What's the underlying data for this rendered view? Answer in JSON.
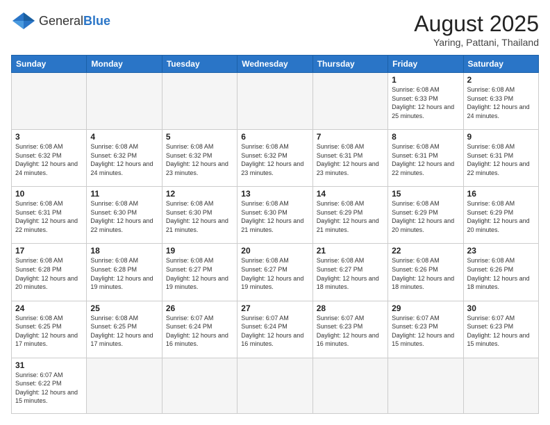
{
  "logo": {
    "text_general": "General",
    "text_blue": "Blue"
  },
  "header": {
    "title": "August 2025",
    "subtitle": "Yaring, Pattani, Thailand"
  },
  "days_of_week": [
    "Sunday",
    "Monday",
    "Tuesday",
    "Wednesday",
    "Thursday",
    "Friday",
    "Saturday"
  ],
  "weeks": [
    [
      {
        "day": "",
        "info": "",
        "empty": true
      },
      {
        "day": "",
        "info": "",
        "empty": true
      },
      {
        "day": "",
        "info": "",
        "empty": true
      },
      {
        "day": "",
        "info": "",
        "empty": true
      },
      {
        "day": "",
        "info": "",
        "empty": true
      },
      {
        "day": "1",
        "info": "Sunrise: 6:08 AM\nSunset: 6:33 PM\nDaylight: 12 hours and 25 minutes."
      },
      {
        "day": "2",
        "info": "Sunrise: 6:08 AM\nSunset: 6:33 PM\nDaylight: 12 hours and 24 minutes."
      }
    ],
    [
      {
        "day": "3",
        "info": "Sunrise: 6:08 AM\nSunset: 6:32 PM\nDaylight: 12 hours and 24 minutes."
      },
      {
        "day": "4",
        "info": "Sunrise: 6:08 AM\nSunset: 6:32 PM\nDaylight: 12 hours and 24 minutes."
      },
      {
        "day": "5",
        "info": "Sunrise: 6:08 AM\nSunset: 6:32 PM\nDaylight: 12 hours and 23 minutes."
      },
      {
        "day": "6",
        "info": "Sunrise: 6:08 AM\nSunset: 6:32 PM\nDaylight: 12 hours and 23 minutes."
      },
      {
        "day": "7",
        "info": "Sunrise: 6:08 AM\nSunset: 6:31 PM\nDaylight: 12 hours and 23 minutes."
      },
      {
        "day": "8",
        "info": "Sunrise: 6:08 AM\nSunset: 6:31 PM\nDaylight: 12 hours and 22 minutes."
      },
      {
        "day": "9",
        "info": "Sunrise: 6:08 AM\nSunset: 6:31 PM\nDaylight: 12 hours and 22 minutes."
      }
    ],
    [
      {
        "day": "10",
        "info": "Sunrise: 6:08 AM\nSunset: 6:31 PM\nDaylight: 12 hours and 22 minutes."
      },
      {
        "day": "11",
        "info": "Sunrise: 6:08 AM\nSunset: 6:30 PM\nDaylight: 12 hours and 22 minutes."
      },
      {
        "day": "12",
        "info": "Sunrise: 6:08 AM\nSunset: 6:30 PM\nDaylight: 12 hours and 21 minutes."
      },
      {
        "day": "13",
        "info": "Sunrise: 6:08 AM\nSunset: 6:30 PM\nDaylight: 12 hours and 21 minutes."
      },
      {
        "day": "14",
        "info": "Sunrise: 6:08 AM\nSunset: 6:29 PM\nDaylight: 12 hours and 21 minutes."
      },
      {
        "day": "15",
        "info": "Sunrise: 6:08 AM\nSunset: 6:29 PM\nDaylight: 12 hours and 20 minutes."
      },
      {
        "day": "16",
        "info": "Sunrise: 6:08 AM\nSunset: 6:29 PM\nDaylight: 12 hours and 20 minutes."
      }
    ],
    [
      {
        "day": "17",
        "info": "Sunrise: 6:08 AM\nSunset: 6:28 PM\nDaylight: 12 hours and 20 minutes."
      },
      {
        "day": "18",
        "info": "Sunrise: 6:08 AM\nSunset: 6:28 PM\nDaylight: 12 hours and 19 minutes."
      },
      {
        "day": "19",
        "info": "Sunrise: 6:08 AM\nSunset: 6:27 PM\nDaylight: 12 hours and 19 minutes."
      },
      {
        "day": "20",
        "info": "Sunrise: 6:08 AM\nSunset: 6:27 PM\nDaylight: 12 hours and 19 minutes."
      },
      {
        "day": "21",
        "info": "Sunrise: 6:08 AM\nSunset: 6:27 PM\nDaylight: 12 hours and 18 minutes."
      },
      {
        "day": "22",
        "info": "Sunrise: 6:08 AM\nSunset: 6:26 PM\nDaylight: 12 hours and 18 minutes."
      },
      {
        "day": "23",
        "info": "Sunrise: 6:08 AM\nSunset: 6:26 PM\nDaylight: 12 hours and 18 minutes."
      }
    ],
    [
      {
        "day": "24",
        "info": "Sunrise: 6:08 AM\nSunset: 6:25 PM\nDaylight: 12 hours and 17 minutes."
      },
      {
        "day": "25",
        "info": "Sunrise: 6:08 AM\nSunset: 6:25 PM\nDaylight: 12 hours and 17 minutes."
      },
      {
        "day": "26",
        "info": "Sunrise: 6:07 AM\nSunset: 6:24 PM\nDaylight: 12 hours and 16 minutes."
      },
      {
        "day": "27",
        "info": "Sunrise: 6:07 AM\nSunset: 6:24 PM\nDaylight: 12 hours and 16 minutes."
      },
      {
        "day": "28",
        "info": "Sunrise: 6:07 AM\nSunset: 6:23 PM\nDaylight: 12 hours and 16 minutes."
      },
      {
        "day": "29",
        "info": "Sunrise: 6:07 AM\nSunset: 6:23 PM\nDaylight: 12 hours and 15 minutes."
      },
      {
        "day": "30",
        "info": "Sunrise: 6:07 AM\nSunset: 6:23 PM\nDaylight: 12 hours and 15 minutes."
      }
    ],
    [
      {
        "day": "31",
        "info": "Sunrise: 6:07 AM\nSunset: 6:22 PM\nDaylight: 12 hours and 15 minutes.",
        "last": true
      },
      {
        "day": "",
        "info": "",
        "empty": true,
        "last": true
      },
      {
        "day": "",
        "info": "",
        "empty": true,
        "last": true
      },
      {
        "day": "",
        "info": "",
        "empty": true,
        "last": true
      },
      {
        "day": "",
        "info": "",
        "empty": true,
        "last": true
      },
      {
        "day": "",
        "info": "",
        "empty": true,
        "last": true
      },
      {
        "day": "",
        "info": "",
        "empty": true,
        "last": true
      }
    ]
  ]
}
